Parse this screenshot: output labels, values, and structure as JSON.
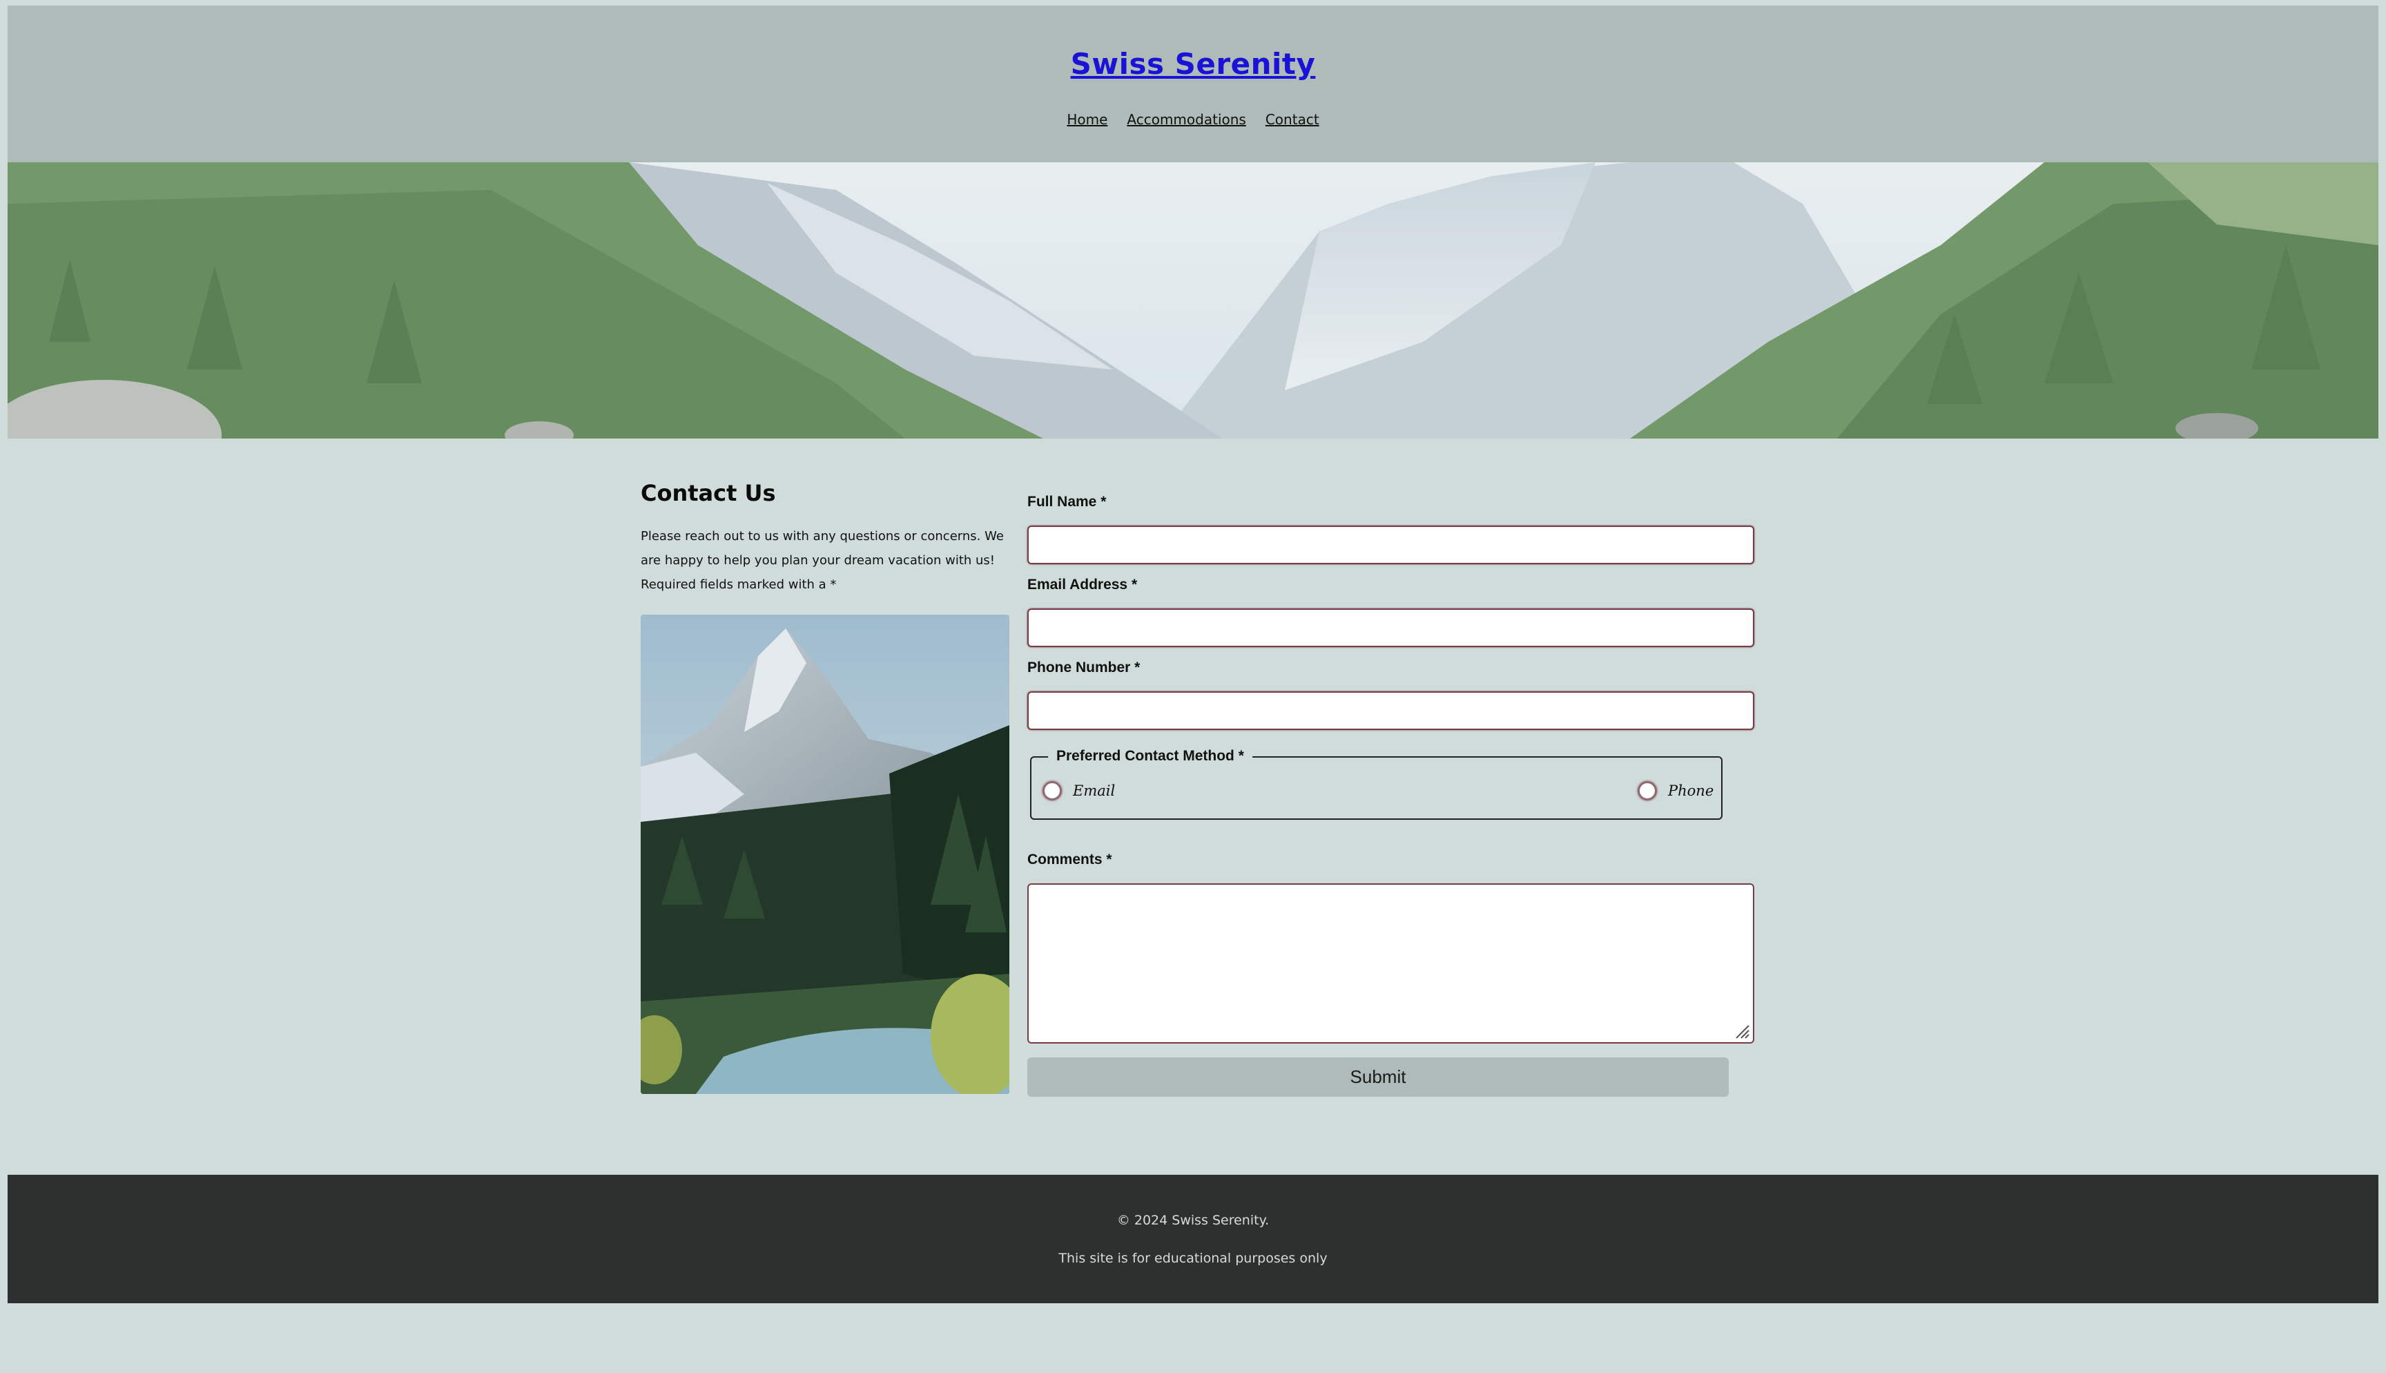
{
  "header": {
    "site_title": "Swiss Serenity",
    "nav": [
      {
        "label": "Home"
      },
      {
        "label": "Accommodations"
      },
      {
        "label": "Contact"
      }
    ]
  },
  "contact": {
    "heading": "Contact Us",
    "intro_line1": "Please reach out to us with any questions or concerns. We",
    "intro_line2": "are happy to help you plan your dream vacation with us!",
    "intro_line3": "Required fields marked with a *"
  },
  "form": {
    "full_name_label": "Full Name *",
    "full_name_value": "",
    "email_label": "Email Address *",
    "email_value": "",
    "phone_label": "Phone Number *",
    "phone_value": "",
    "contact_method_legend": "Preferred Contact Method *",
    "contact_method_options": [
      {
        "label": "Email",
        "checked": false
      },
      {
        "label": "Phone",
        "checked": false
      }
    ],
    "comments_label": "Comments *",
    "comments_value": "",
    "submit_label": "Submit"
  },
  "footer": {
    "copyright": "© 2024 Swiss Serenity.",
    "disclaimer": "This site is for educational purposes only"
  },
  "colors": {
    "page_bg": "#d0dcda",
    "header_bg": "#aebbb8",
    "footer_bg": "#2e3030",
    "title_link": "#1a12d6",
    "input_border": "#7a3c45"
  }
}
